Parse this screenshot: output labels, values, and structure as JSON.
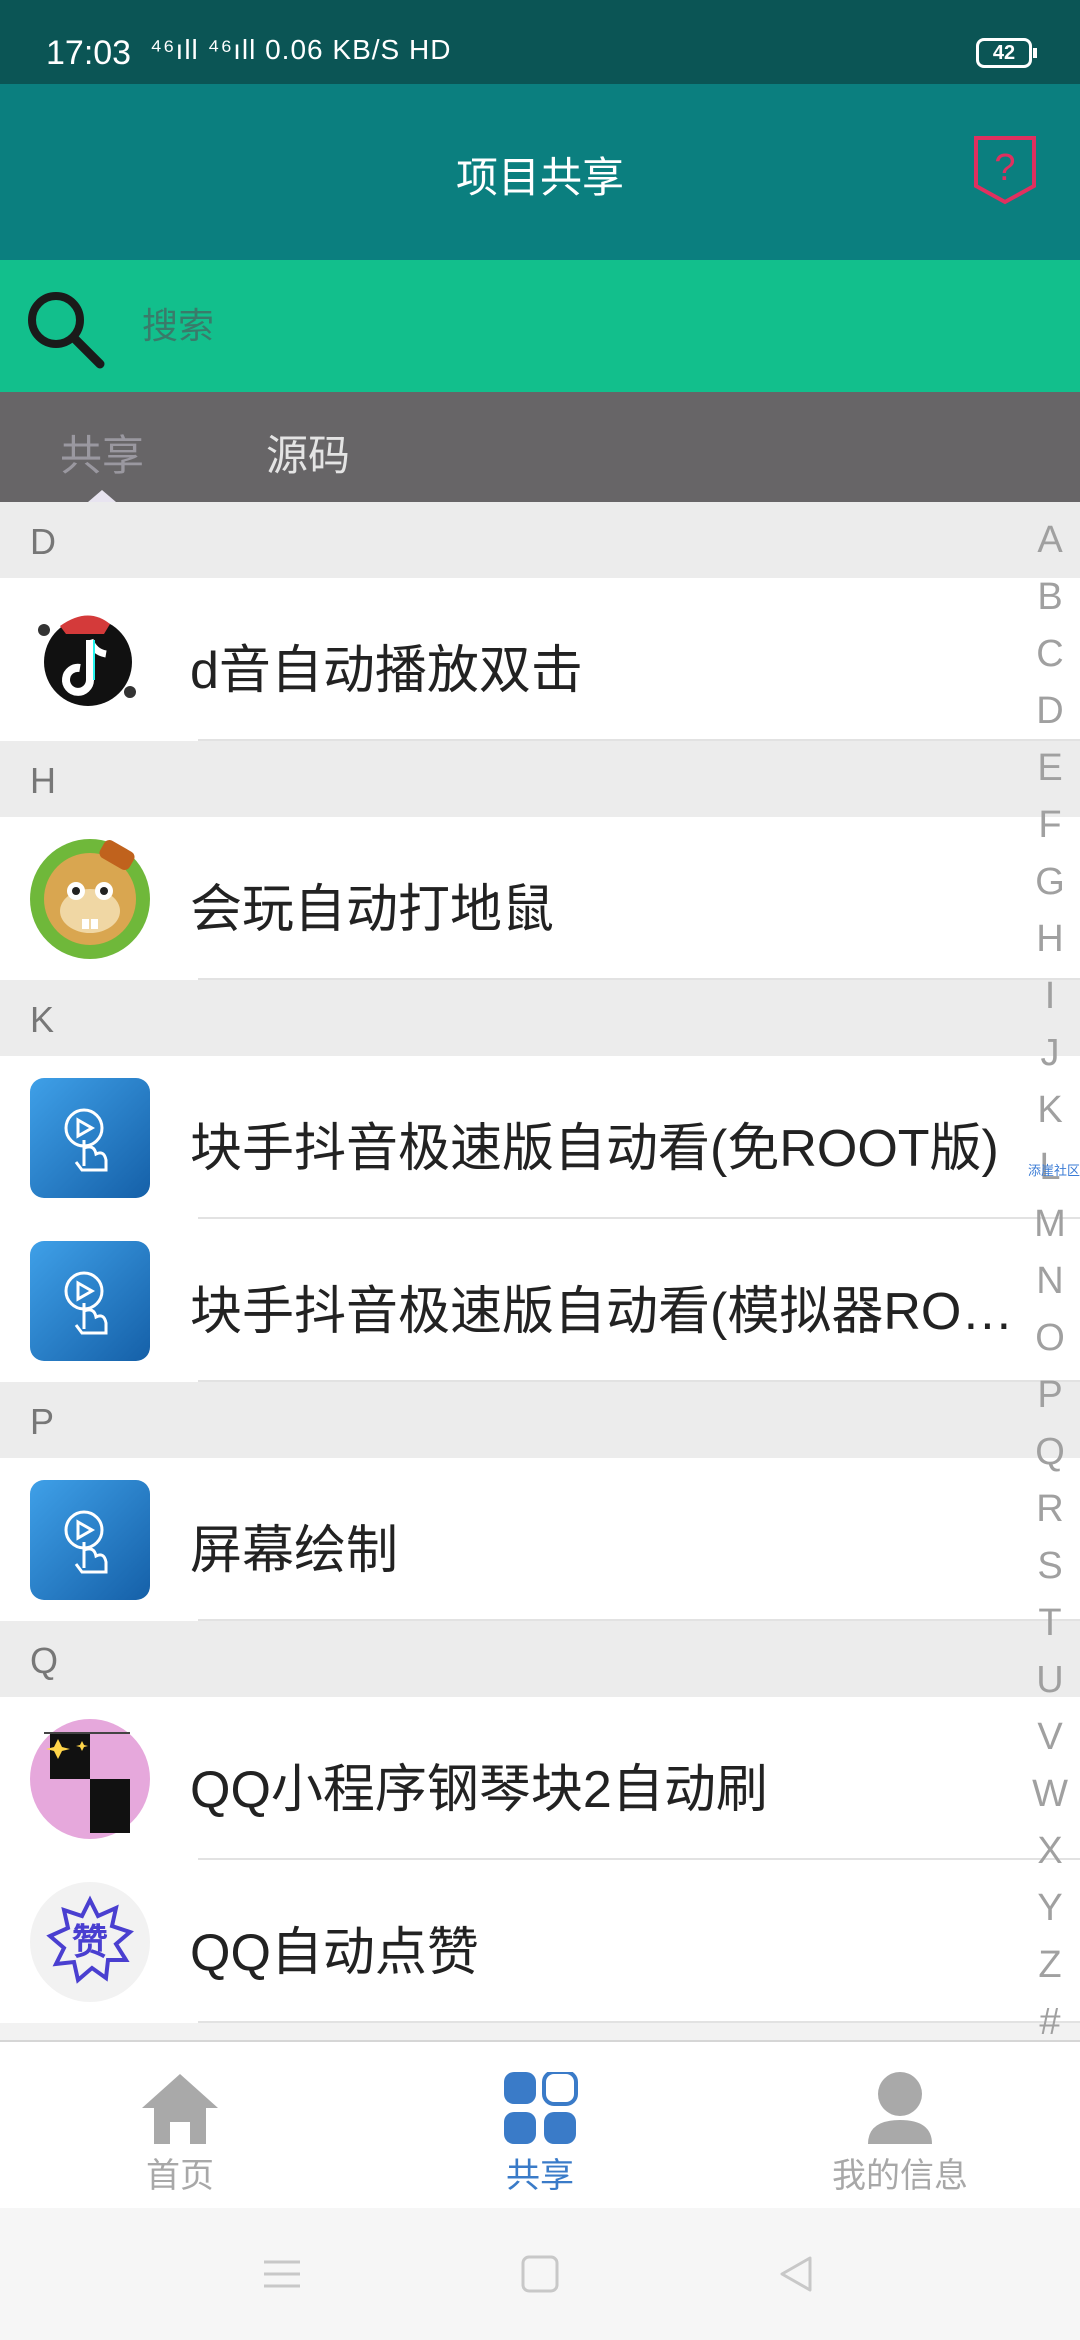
{
  "status_bar": {
    "time": "17:03",
    "network": "⁴⁶ıll ⁴⁶ıll 0.06 KB/S HD",
    "battery": "42"
  },
  "header": {
    "title": "项目共享",
    "help_symbol": "?"
  },
  "search": {
    "placeholder": "搜索"
  },
  "tabs": [
    {
      "label": "共享"
    },
    {
      "label": "源码"
    }
  ],
  "sections": [
    {
      "letter": "D",
      "items": [
        {
          "label": "d音自动播放双击",
          "icon": "tiktok-icon"
        }
      ]
    },
    {
      "letter": "H",
      "items": [
        {
          "label": "会玩自动打地鼠",
          "icon": "whack-mole-icon"
        }
      ]
    },
    {
      "letter": "K",
      "items": [
        {
          "label": "块手抖音极速版自动看(免ROOT版)",
          "icon": "touch-play-icon"
        },
        {
          "label": "块手抖音极速版自动看(模拟器ROOT版)",
          "icon": "touch-play-icon"
        }
      ]
    },
    {
      "letter": "P",
      "items": [
        {
          "label": "屏幕绘制",
          "icon": "touch-play-icon"
        }
      ]
    },
    {
      "letter": "Q",
      "items": [
        {
          "label": "QQ小程序钢琴块2自动刷",
          "icon": "piano-tiles-icon"
        },
        {
          "label": "QQ自动点赞",
          "icon": "like-badge-icon"
        }
      ]
    }
  ],
  "alpha_index": [
    "A",
    "B",
    "C",
    "D",
    "E",
    "F",
    "G",
    "H",
    "I",
    "J",
    "K",
    "L",
    "M",
    "N",
    "O",
    "P",
    "Q",
    "R",
    "S",
    "T",
    "U",
    "V",
    "W",
    "X",
    "Y",
    "Z",
    "#"
  ],
  "watermark": "添崖社区",
  "bottom_nav": [
    {
      "label": "首页",
      "icon": "home-icon",
      "active": false
    },
    {
      "label": "共享",
      "icon": "grid-icon",
      "active": true
    },
    {
      "label": "我的信息",
      "icon": "user-icon",
      "active": false
    }
  ],
  "colors": {
    "status_bar": "#0b5555",
    "header": "#0b7f7f",
    "search_bar": "#12bf8c",
    "tabs": "#676567",
    "active_nav": "#3a7bc8"
  }
}
